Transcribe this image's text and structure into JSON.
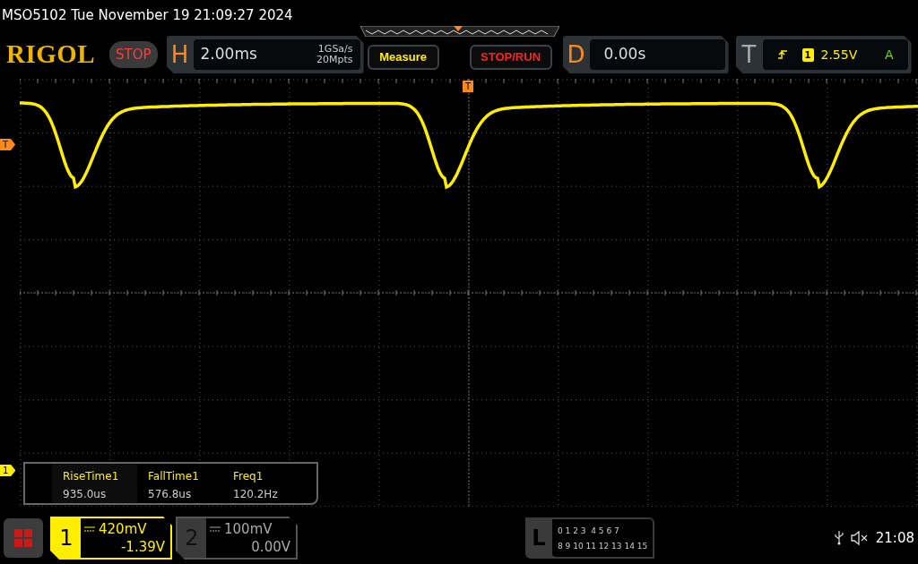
{
  "title_bar": {
    "text": "MSO5102  Tue November 19 21:09:27 2024"
  },
  "logo": "RIGOL",
  "run_status": "STOP",
  "horizontal": {
    "label": "H",
    "timebase": "2.00ms",
    "sample_rate": "1GSa/s",
    "memory_depth": "20Mpts"
  },
  "buttons": [
    {
      "label": "Measure",
      "kind": "measure"
    },
    {
      "label": "STOP/RUN",
      "kind": "run"
    }
  ],
  "delay": {
    "label": "D",
    "value": "0.00s"
  },
  "trigger": {
    "label": "T",
    "source": "1",
    "level": "2.55V",
    "mode": "A"
  },
  "markers": {
    "trigger_position": "T",
    "trigger_level": "T",
    "channel": "1"
  },
  "measurements": [
    {
      "name": "RiseTime1",
      "value": "935.0us"
    },
    {
      "name": "FallTime1",
      "value": "576.8us"
    },
    {
      "name": "Freq1",
      "value": "120.2Hz"
    }
  ],
  "channels": [
    {
      "number": "1",
      "scale": "420mV",
      "offset": "-1.39V",
      "selected": true
    },
    {
      "number": "2",
      "scale": "100mV",
      "offset": "0.00V",
      "selected": false
    }
  ],
  "logic": {
    "label": "L",
    "rows": [
      "0 1 2 3  4 5 6 7",
      "8 9 10 11 12 13 14 15"
    ]
  },
  "clock": "21:08"
}
